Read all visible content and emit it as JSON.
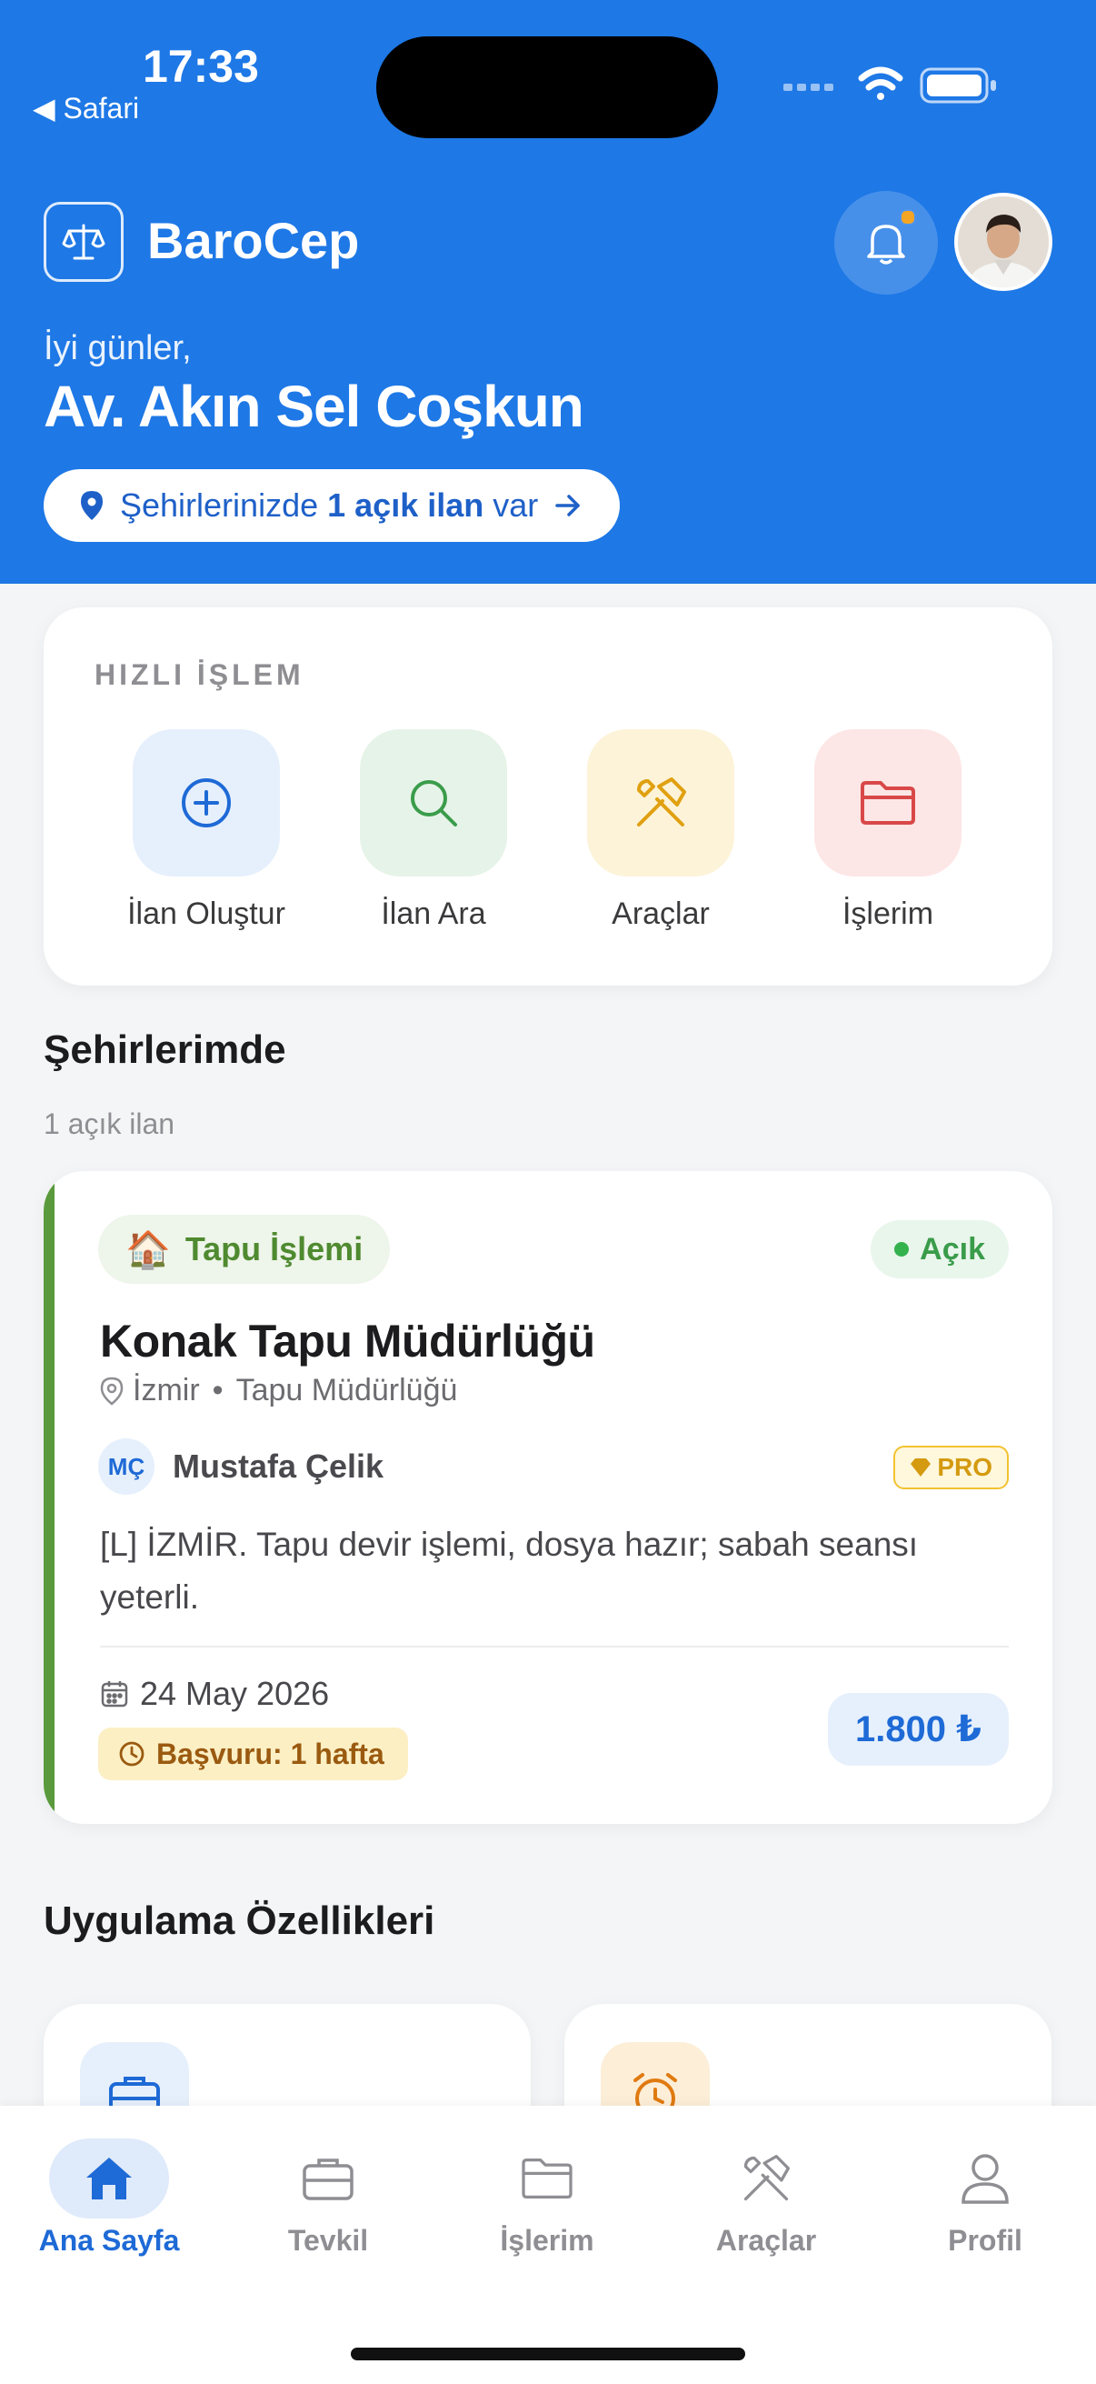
{
  "status_bar": {
    "time": "17:33",
    "back_label": "◀ Safari"
  },
  "header": {
    "app_name": "BaroCep",
    "greeting": "İyi günler,",
    "user_name": "Av. Akın Sel Coşkun",
    "city_notice": {
      "prefix": "Şehirlerinizde ",
      "count_text": "1 açık ilan",
      "suffix": " var"
    }
  },
  "quick_actions": {
    "title": "HIZLI İŞLEM",
    "items": [
      {
        "label": "İlan Oluştur",
        "icon": "plus-circle-icon",
        "color": "#1e6ad6",
        "bg": "#e6f0fc"
      },
      {
        "label": "İlan Ara",
        "icon": "search-icon",
        "color": "#3a9c4a",
        "bg": "#e6f3e8"
      },
      {
        "label": "Araçlar",
        "icon": "tools-icon",
        "color": "#e0a010",
        "bg": "#fdf3d8"
      },
      {
        "label": "İşlerim",
        "icon": "folder-icon",
        "color": "#d94848",
        "bg": "#fde6e6"
      }
    ]
  },
  "cities_section": {
    "title": "Şehirlerimde",
    "subtitle": "1 açık ilan"
  },
  "listing": {
    "category": "Tapu İşlemi",
    "status": "Açık",
    "title": "Konak Tapu Müdürlüğü",
    "city": "İzmir",
    "office": "Tapu Müdürlüğü",
    "poster_initials": "MÇ",
    "poster_name": "Mustafa Çelik",
    "poster_badge": "PRO",
    "description": "[L] İZMİR. Tapu devir işlemi, dosya hazır; sabah seansı yeterli.",
    "date": "24 May 2026",
    "deadline": "Başvuru: 1 hafta",
    "price": "1.800 ₺"
  },
  "features_section": {
    "title": "Uygulama Özellikleri"
  },
  "tabbar": {
    "items": [
      {
        "label": "Ana Sayfa",
        "icon": "home-icon",
        "active": true
      },
      {
        "label": "Tevkil",
        "icon": "briefcase-icon",
        "active": false
      },
      {
        "label": "İşlerim",
        "icon": "folder-icon",
        "active": false
      },
      {
        "label": "Araçlar",
        "icon": "tools-icon",
        "active": false
      },
      {
        "label": "Profil",
        "icon": "person-icon",
        "active": false
      }
    ]
  },
  "colors": {
    "primary": "#1e78e6",
    "accent_green": "#5a9a3c",
    "price_blue": "#1e6ad6"
  }
}
